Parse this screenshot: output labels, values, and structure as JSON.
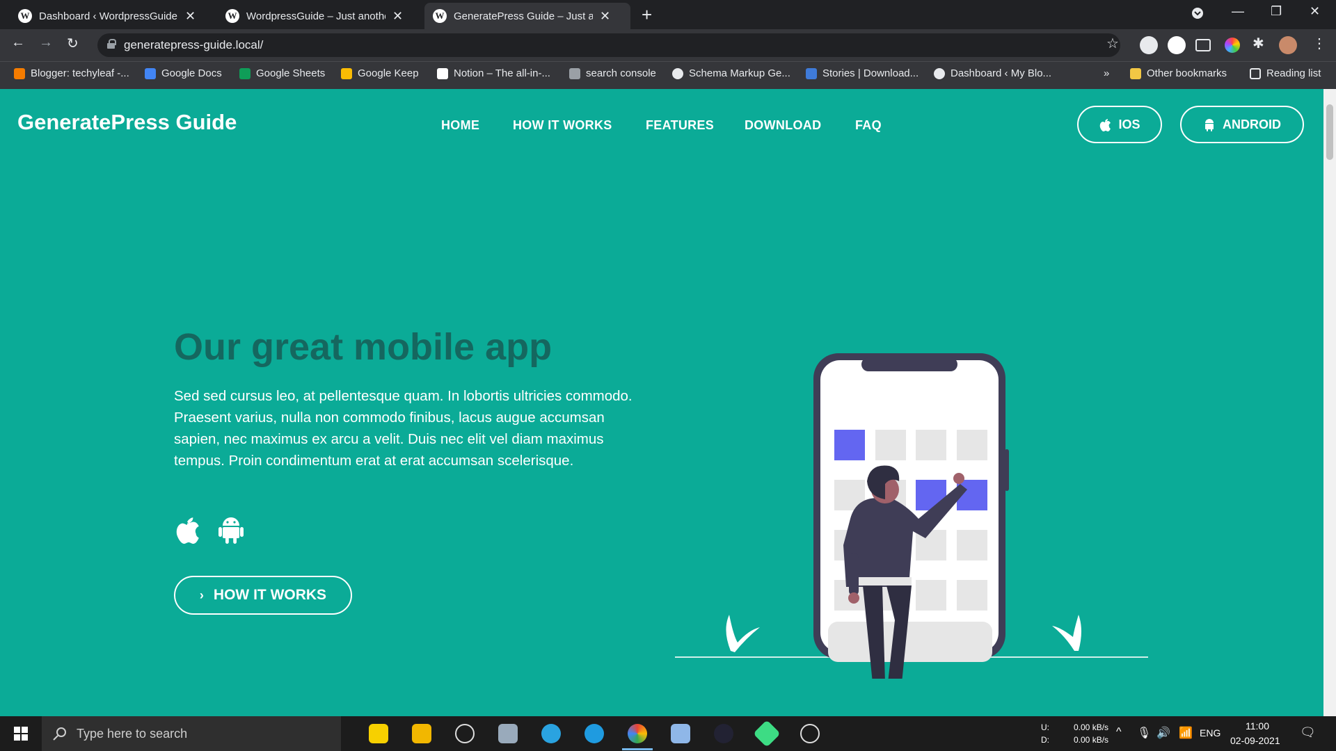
{
  "browser": {
    "tabs": [
      {
        "title": "Dashboard ‹ WordpressGuide —",
        "active": false
      },
      {
        "title": "WordpressGuide – Just another W",
        "active": false
      },
      {
        "title": "GeneratePress Guide – Just anoth",
        "active": true
      }
    ],
    "url": "generatepress-guide.local/",
    "bookmarks": [
      "Blogger: techyleaf -...",
      "Google Docs",
      "Google Sheets",
      "Google Keep",
      "Notion – The all-in-...",
      "search console",
      "Schema Markup Ge...",
      "Stories | Download...",
      "Dashboard ‹ My Blo..."
    ],
    "more_bookmarks": "»",
    "other_bookmarks": "Other bookmarks",
    "reading_list": "Reading list"
  },
  "site": {
    "logo": "GeneratePress Guide",
    "nav": [
      "HOME",
      "HOW IT WORKS",
      "FEATURES",
      "DOWNLOAD",
      "FAQ"
    ],
    "ios_button": "IOS",
    "android_button": "ANDROID",
    "heading": "Our great mobile app",
    "paragraph": "Sed sed cursus leo, at pellentesque quam. In lobortis ultricies commodo. Praesent varius, nulla non commodo finibus, lacus augue accumsan sapien, nec maximus ex arcu a velit. Duis nec elit vel diam maximus tempus. Proin condimentum erat at erat accumsan scelerisque.",
    "cta": "HOW IT WORKS",
    "accent": "#0bab97",
    "heading_color": "#15675f",
    "tile_accent": "#6366f1"
  },
  "taskbar": {
    "search_placeholder": "Type here to search",
    "net_up_label": "U:",
    "net_down_label": "D:",
    "net_up": "0.00 kB/s",
    "net_down": "0.00 kB/s",
    "language": "ENG",
    "time": "11:00",
    "date": "02-09-2021"
  }
}
